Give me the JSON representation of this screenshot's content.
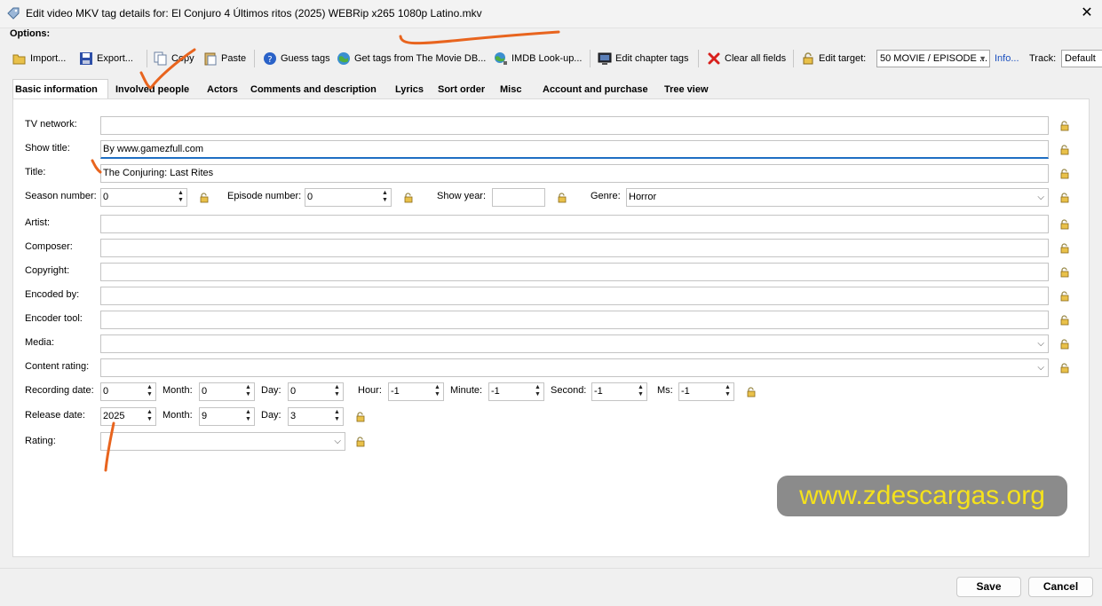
{
  "window": {
    "title": "Edit video MKV tag details for: El Conjuro 4 Últimos ritos (2025) WEBRip x265 1080p Latino.mkv",
    "close_glyph": "✕"
  },
  "options_label": "Options:",
  "toolbar": {
    "import": "Import...",
    "export": "Export...",
    "copy": "Copy",
    "paste": "Paste",
    "guess": "Guess tags",
    "moviedb": "Get tags from The Movie DB...",
    "imdb": "IMDB Look-up...",
    "chapter": "Edit chapter tags",
    "clear": "Clear all fields",
    "edit_target_label": "Edit target:",
    "edit_target_value": "50 MOVIE / EPISODE ...",
    "info": "Info...",
    "track_label": "Track:",
    "track_value": "Default"
  },
  "tabs": [
    "Basic information",
    "Involved people",
    "Actors",
    "Comments and description",
    "Lyrics",
    "Sort order",
    "Misc",
    "Account and purchase",
    "Tree view"
  ],
  "fields": {
    "tv_network": {
      "label": "TV network:",
      "value": ""
    },
    "show_title": {
      "label": "Show title:",
      "value": "By www.gamezfull.com"
    },
    "title": {
      "label": "Title:",
      "value": "The Conjuring: Last Rites"
    },
    "season_number": {
      "label": "Season number:",
      "value": "0"
    },
    "episode_number": {
      "label": "Episode number:",
      "value": "0"
    },
    "show_year": {
      "label": "Show year:",
      "value": ""
    },
    "genre": {
      "label": "Genre:",
      "value": "Horror"
    },
    "artist": {
      "label": "Artist:",
      "value": ""
    },
    "composer": {
      "label": "Composer:",
      "value": ""
    },
    "copyright": {
      "label": "Copyright:",
      "value": ""
    },
    "encoded_by": {
      "label": "Encoded by:",
      "value": ""
    },
    "encoder_tool": {
      "label": "Encoder tool:",
      "value": ""
    },
    "media": {
      "label": "Media:",
      "value": ""
    },
    "content_rating": {
      "label": "Content rating:",
      "value": ""
    },
    "rating": {
      "label": "Rating:",
      "value": ""
    }
  },
  "recording_date": {
    "label": "Recording date:",
    "year": "0",
    "month_label": "Month:",
    "month": "0",
    "day_label": "Day:",
    "day": "0",
    "hour_label": "Hour:",
    "hour": "-1",
    "minute_label": "Minute:",
    "minute": "-1",
    "second_label": "Second:",
    "second": "-1",
    "ms_label": "Ms:",
    "ms": "-1"
  },
  "release_date": {
    "label": "Release date:",
    "year": "2025",
    "month_label": "Month:",
    "month": "9",
    "day_label": "Day:",
    "day": "3"
  },
  "watermark": "www.zdescargas.org",
  "buttons": {
    "save": "Save",
    "cancel": "Cancel"
  },
  "colors": {
    "annotation": "#e8641e",
    "watermark_text": "#f5e21c",
    "watermark_bg": "#8b8b8b",
    "focus": "#1f6fc3",
    "link": "#1a4fbf"
  }
}
